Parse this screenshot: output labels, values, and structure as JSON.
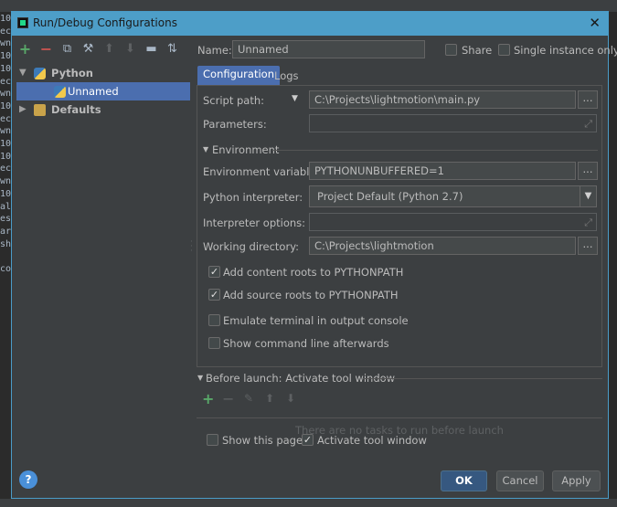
{
  "dialog": {
    "title": "Run/Debug Configurations",
    "close_icon": "close-icon"
  },
  "toolbar": {
    "icons": [
      "add-icon",
      "remove-icon",
      "copy-icon",
      "wrench-icon",
      "move-up-icon",
      "move-down-icon",
      "folder-icon",
      "sort-icon"
    ]
  },
  "tree": {
    "python": "Python",
    "unnamed": "Unnamed",
    "defaults": "Defaults"
  },
  "form": {
    "name_label": "Name:",
    "name_value": "Unnamed",
    "share_label": "Share",
    "single_instance_label": "Single instance only",
    "tab_configuration": "Configuration",
    "tab_logs": "Logs",
    "script_path_label": "Script path:",
    "script_path_value": "C:\\Projects\\lightmotion\\main.py",
    "parameters_label": "Parameters:",
    "parameters_value": "",
    "environment_header": "Environment",
    "env_vars_label": "Environment variables:",
    "env_vars_value": "PYTHONUNBUFFERED=1",
    "python_interpreter_label": "Python interpreter:",
    "python_interpreter_value": "Project Default (Python 2.7)",
    "interpreter_options_label": "Interpreter options:",
    "interpreter_options_value": "",
    "working_dir_label": "Working directory:",
    "working_dir_value": "C:\\Projects\\lightmotion",
    "dots": "...",
    "add_content_roots": "Add content roots to PYTHONPATH",
    "add_source_roots": "Add source roots to PYTHONPATH",
    "emulate_terminal": "Emulate terminal in output console",
    "show_command_line": "Show command line afterwards",
    "add_content_roots_checked": true,
    "add_source_roots_checked": true,
    "emulate_terminal_checked": false,
    "show_command_line_checked": false
  },
  "before_launch": {
    "header": "Before launch: Activate tool window",
    "empty_text": "There are no tasks to run before launch",
    "show_this_page": "Show this page",
    "activate_tool_window": "Activate tool window",
    "show_this_page_checked": false,
    "activate_tool_window_checked": true
  },
  "buttons": {
    "ok": "OK",
    "cancel": "Cancel",
    "apply": "Apply",
    "help": "?"
  },
  "background_ide": {
    "gutter_lines": [
      "10",
      "ec",
      "wn",
      "10",
      "10",
      "ec",
      "wn",
      "10",
      "ec",
      "wn",
      "10",
      "10",
      "ec",
      "wn",
      "10",
      "al",
      "es",
      "ar",
      "sh",
      "",
      "co"
    ]
  },
  "colors": {
    "accent": "#4d9ec8",
    "selection": "#4b6eaf",
    "ok_button": "#365880"
  }
}
